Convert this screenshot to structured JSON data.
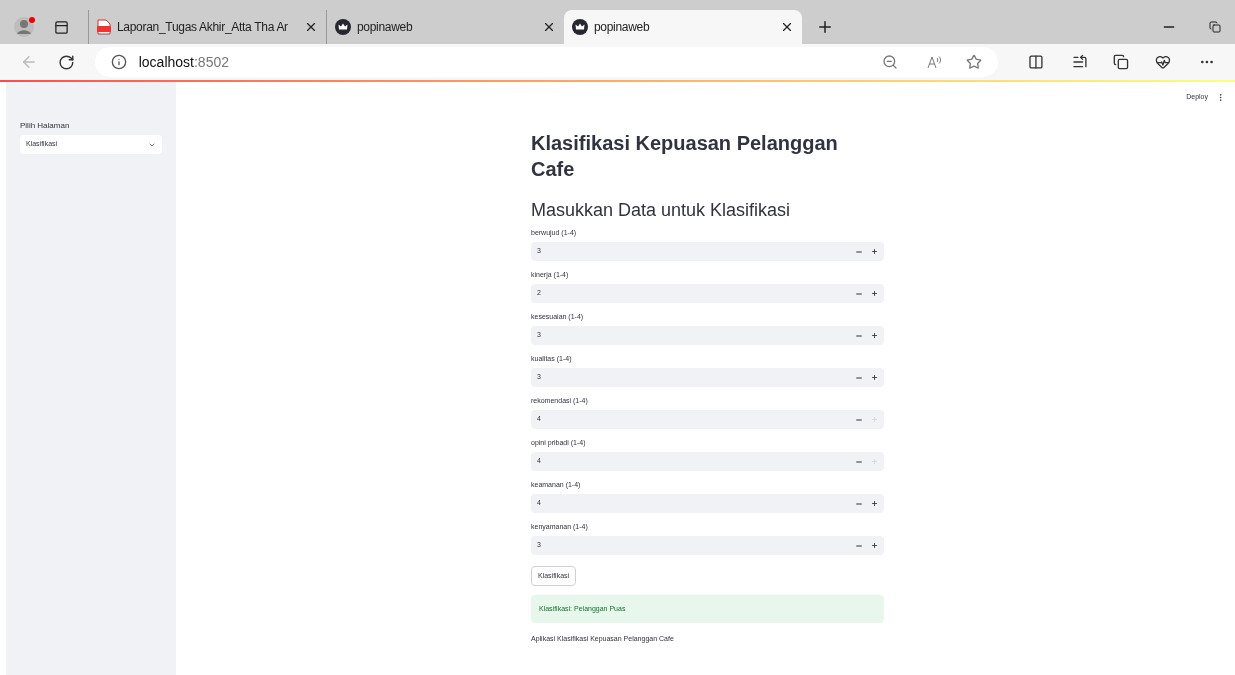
{
  "browser": {
    "tabs": [
      {
        "title": "Laporan_Tugas Akhir_Atta Tha Ar",
        "kind": "pdf",
        "selected": false
      },
      {
        "title": "popinaweb",
        "kind": "site",
        "selected": false
      },
      {
        "title": "popinaweb",
        "kind": "site",
        "selected": true
      }
    ],
    "address": {
      "host": "localhost",
      "port": ":8502"
    }
  },
  "app": {
    "deploy": "Deploy",
    "sidebar": {
      "label": "Pilih Halaman",
      "select_value": "Klasifikasi"
    },
    "title": "Klasifikasi Kepuasan Pelanggan Cafe",
    "subtitle": "Masukkan Data untuk Klasifikasi",
    "fields": [
      {
        "label": "berwujud (1-4)",
        "value": "3",
        "plus_disabled": false
      },
      {
        "label": "kinerja (1-4)",
        "value": "2",
        "plus_disabled": false
      },
      {
        "label": "kesesuaian (1-4)",
        "value": "3",
        "plus_disabled": false
      },
      {
        "label": "kualitas (1-4)",
        "value": "3",
        "plus_disabled": false
      },
      {
        "label": "rekomendasi (1-4)",
        "value": "4",
        "plus_disabled": true
      },
      {
        "label": "opini pribadi (1-4)",
        "value": "4",
        "plus_disabled": true
      },
      {
        "label": "keamanan (1-4)",
        "value": "4",
        "plus_disabled": false
      },
      {
        "label": "kenyamanan (1-4)",
        "value": "3",
        "plus_disabled": false
      }
    ],
    "button": "Klasifikasi",
    "result": "Klasifikasi: Pelanggan Puas",
    "footer": "Aplikasi Klasifikasi Kepuasan Pelanggan Cafe"
  }
}
